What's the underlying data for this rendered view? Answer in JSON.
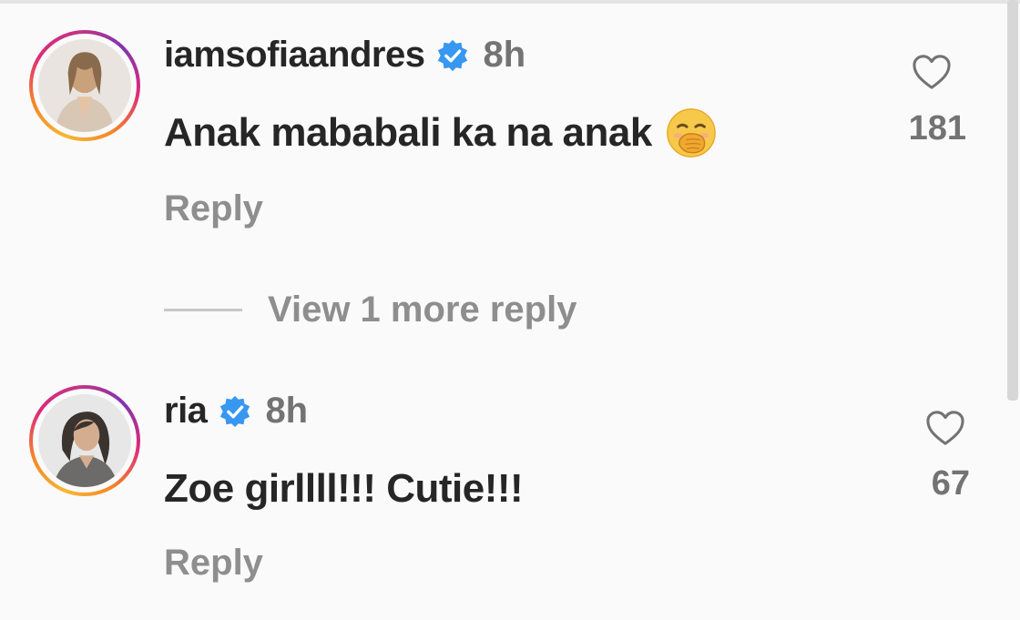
{
  "comments": [
    {
      "username": "iamsofiaandres",
      "time": "8h",
      "text": "Anak mababali ka na anak",
      "emoji": "face-with-hand-over-mouth",
      "likes": "181",
      "reply_label": "Reply",
      "verified": true
    },
    {
      "username": "ria",
      "time": "8h",
      "text": "Zoe girllll!!! Cutie!!!",
      "likes": "67",
      "reply_label": "Reply",
      "verified": true
    }
  ],
  "view_more": {
    "label": "View 1 more reply"
  },
  "colors": {
    "verified_blue": "#3897f0",
    "text_primary": "#262626",
    "text_secondary": "#8e8e8e",
    "background": "#fafafa"
  }
}
